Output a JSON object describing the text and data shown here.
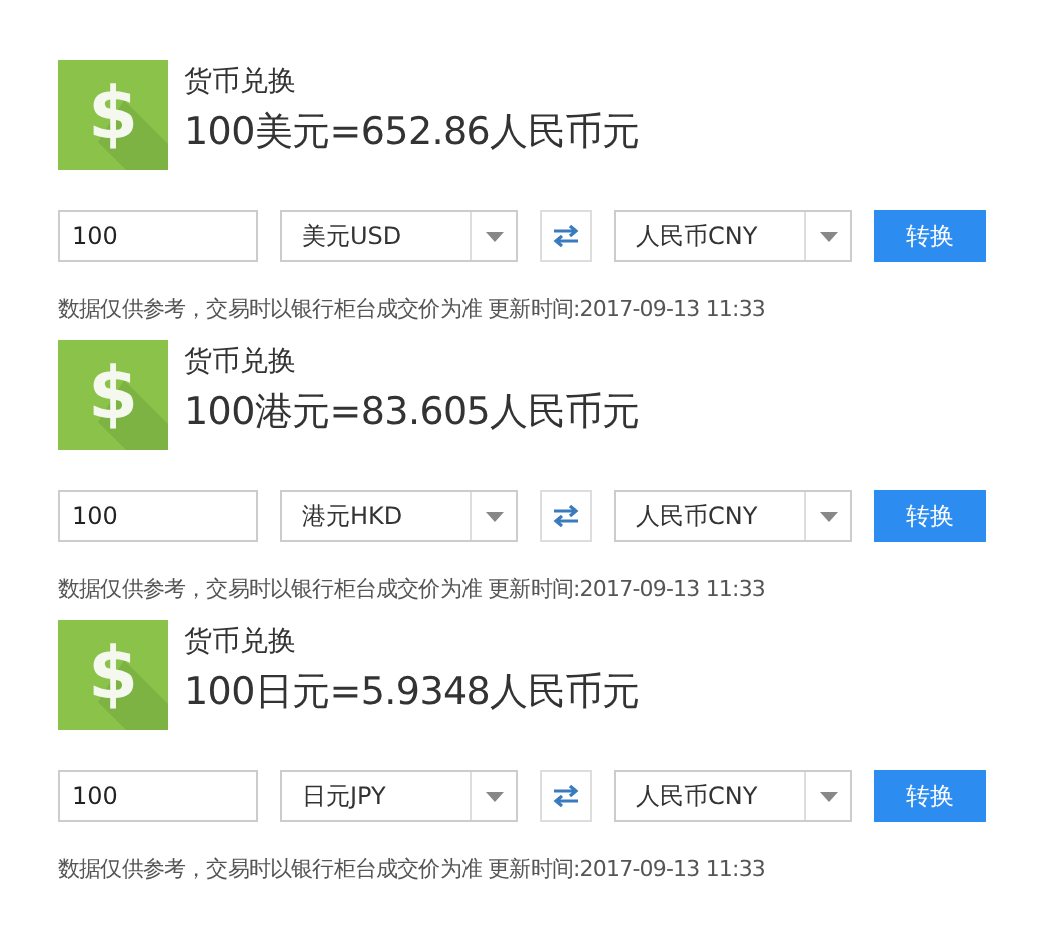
{
  "converters": [
    {
      "icon_glyph": "$",
      "title": "货币兑换",
      "result": "100美元=652.86人民币元",
      "amount": "100",
      "from_currency": "美元USD",
      "to_currency": "人民币CNY",
      "convert_button": "转换",
      "note": "数据仅供参考，交易时以银行柜台成交价为准 更新时间:2017-09-13 11:33"
    },
    {
      "icon_glyph": "$",
      "title": "货币兑换",
      "result": "100港元=83.605人民币元",
      "amount": "100",
      "from_currency": "港元HKD",
      "to_currency": "人民币CNY",
      "convert_button": "转换",
      "note": "数据仅供参考，交易时以银行柜台成交价为准 更新时间:2017-09-13 11:33"
    },
    {
      "icon_glyph": "$",
      "title": "货币兑换",
      "result": "100日元=5.9348人民币元",
      "amount": "100",
      "from_currency": "日元JPY",
      "to_currency": "人民币CNY",
      "convert_button": "转换",
      "note": "数据仅供参考，交易时以银行柜台成交价为准 更新时间:2017-09-13 11:33"
    }
  ]
}
